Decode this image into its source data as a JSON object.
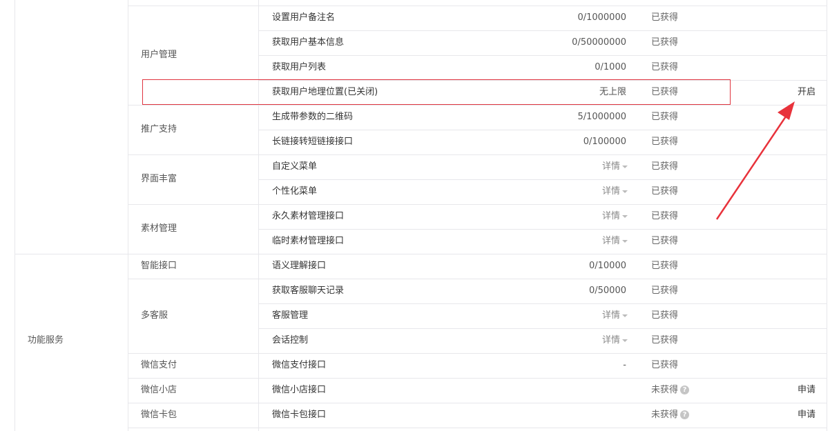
{
  "groups": [
    {
      "label": "",
      "row_start": 0,
      "row_end": 9
    },
    {
      "label": "功能服务",
      "row_start": 10,
      "row_end": 16
    }
  ],
  "categories": [
    {
      "label": "用户管理",
      "row_start": 0,
      "row_end": 3
    },
    {
      "label": "推广支持",
      "row_start": 4,
      "row_end": 5
    },
    {
      "label": "界面丰富",
      "row_start": 6,
      "row_end": 7
    },
    {
      "label": "素材管理",
      "row_start": 8,
      "row_end": 9
    },
    {
      "label": "智能接口",
      "row_start": 10,
      "row_end": 10
    },
    {
      "label": "多客服",
      "row_start": 11,
      "row_end": 13
    },
    {
      "label": "微信支付",
      "row_start": 14,
      "row_end": 14
    },
    {
      "label": "微信小店",
      "row_start": 15,
      "row_end": 15
    },
    {
      "label": "微信卡包",
      "row_start": 16,
      "row_end": 16
    }
  ],
  "rows": [
    {
      "api": "设置用户备注名",
      "quota": "0/1000000",
      "quota_type": "text",
      "status": "已获得",
      "status_help": false,
      "action": ""
    },
    {
      "api": "获取用户基本信息",
      "quota": "0/50000000",
      "quota_type": "text",
      "status": "已获得",
      "status_help": false,
      "action": ""
    },
    {
      "api": "获取用户列表",
      "quota": "0/1000",
      "quota_type": "text",
      "status": "已获得",
      "status_help": false,
      "action": ""
    },
    {
      "api": "获取用户地理位置(已关闭)",
      "quota": "无上限",
      "quota_type": "text",
      "status": "已获得",
      "status_help": false,
      "action": "开启"
    },
    {
      "api": "生成带参数的二维码",
      "quota": "5/1000000",
      "quota_type": "text",
      "status": "已获得",
      "status_help": false,
      "action": ""
    },
    {
      "api": "长链接转短链接接口",
      "quota": "0/100000",
      "quota_type": "text",
      "status": "已获得",
      "status_help": false,
      "action": ""
    },
    {
      "api": "自定义菜单",
      "quota": "详情",
      "quota_type": "detail",
      "status": "已获得",
      "status_help": false,
      "action": ""
    },
    {
      "api": "个性化菜单",
      "quota": "详情",
      "quota_type": "detail",
      "status": "已获得",
      "status_help": false,
      "action": ""
    },
    {
      "api": "永久素材管理接口",
      "quota": "详情",
      "quota_type": "detail",
      "status": "已获得",
      "status_help": false,
      "action": ""
    },
    {
      "api": "临时素材管理接口",
      "quota": "详情",
      "quota_type": "detail",
      "status": "已获得",
      "status_help": false,
      "action": ""
    },
    {
      "api": "语义理解接口",
      "quota": "0/10000",
      "quota_type": "text",
      "status": "已获得",
      "status_help": false,
      "action": ""
    },
    {
      "api": "获取客服聊天记录",
      "quota": "0/50000",
      "quota_type": "text",
      "status": "已获得",
      "status_help": false,
      "action": ""
    },
    {
      "api": "客服管理",
      "quota": "详情",
      "quota_type": "detail",
      "status": "已获得",
      "status_help": false,
      "action": ""
    },
    {
      "api": "会话控制",
      "quota": "详情",
      "quota_type": "detail",
      "status": "已获得",
      "status_help": false,
      "action": ""
    },
    {
      "api": "微信支付接口",
      "quota": "-",
      "quota_type": "text",
      "status": "已获得",
      "status_help": false,
      "action": ""
    },
    {
      "api": "微信小店接口",
      "quota": "",
      "quota_type": "text",
      "status": "未获得",
      "status_help": true,
      "action": "申请"
    },
    {
      "api": "微信卡包接口",
      "quota": "",
      "quota_type": "text",
      "status": "未获得",
      "status_help": true,
      "action": "申请"
    }
  ],
  "help_icon_glyph": "?",
  "colors": {
    "highlight": "#e0343f",
    "arrow": "#e8323b",
    "border": "#e7e7eb"
  }
}
